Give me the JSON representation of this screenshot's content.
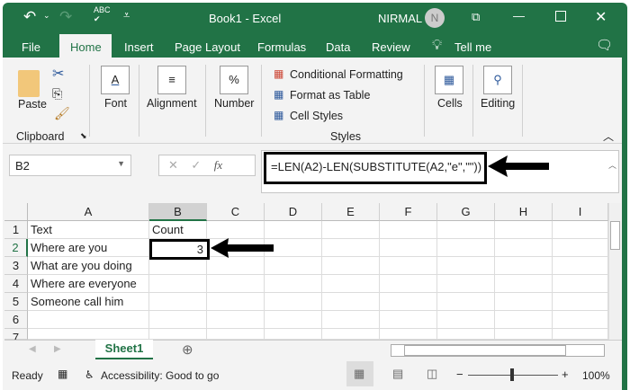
{
  "title_bar": {
    "title": "Book1  -  Excel",
    "user": "NIRMAL",
    "avatar_initial": "N"
  },
  "tabs": [
    "File",
    "Home",
    "Insert",
    "Page Layout",
    "Formulas",
    "Data",
    "Review",
    "Tell me"
  ],
  "ribbon": {
    "paste": "Paste",
    "clipboard": "Clipboard",
    "font": "Font",
    "alignment": "Alignment",
    "number": "Number",
    "number_glyph": "%",
    "font_glyph": "A",
    "conditional_formatting": "Conditional Formatting",
    "format_as_table": "Format as Table",
    "cell_styles": "Cell Styles",
    "styles": "Styles",
    "cells": "Cells",
    "editing": "Editing"
  },
  "formula_bar": {
    "name_box": "B2",
    "fx": "fx",
    "formula": "=LEN(A2)-LEN(SUBSTITUTE(A2,\"e\",\"\"))"
  },
  "columns": [
    "A",
    "B",
    "C",
    "D",
    "E",
    "F",
    "G",
    "H",
    "I"
  ],
  "rows": [
    "1",
    "2",
    "3",
    "4",
    "5",
    "6",
    "7"
  ],
  "cells": {
    "A1": "Text",
    "B1": "Count",
    "A2": "Where are you",
    "B2": "3",
    "A3": "What are you doing",
    "A4": "Where are everyone",
    "A5": "Someone call him"
  },
  "sheet_tab": "Sheet1",
  "status": {
    "ready": "Ready",
    "accessibility": "Accessibility: Good to go",
    "zoom": "100%"
  },
  "colors": {
    "brand": "#217346"
  }
}
